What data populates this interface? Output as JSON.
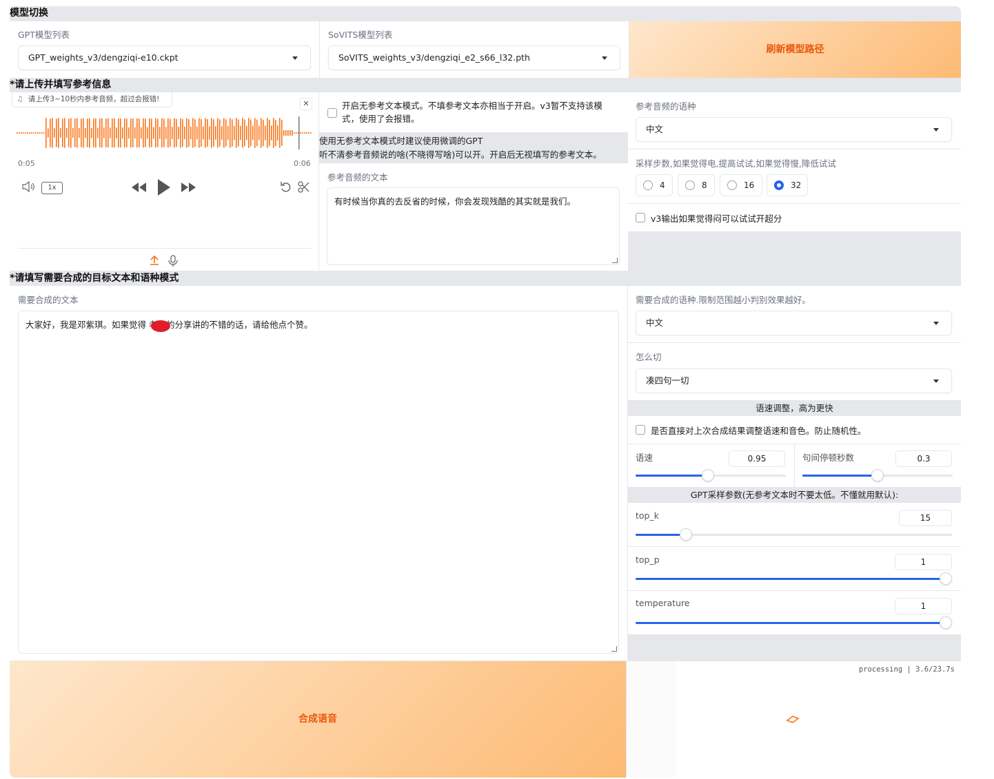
{
  "model_switch": {
    "section_title": "模型切换",
    "gpt_label": "GPT模型列表",
    "gpt_value": "GPT_weights_v3/dengziqi-e10.ckpt",
    "sovits_label": "SoVITS模型列表",
    "sovits_value": "SoVITS_weights_v3/dengziqi_e2_s66_l32.pth",
    "refresh_button": "刷新模型路径"
  },
  "reference": {
    "section_title": "*请上传并填写参考信息",
    "audio_hint": "请上传3~10秒内参考音频，超过会报错!",
    "time_current": "0:05",
    "time_total": "0:06",
    "speed": "1x",
    "no_ref_checkbox_label": "开启无参考文本模式。不填参考文本亦相当于开启。v3暂不支持该模式，使用了会报错。",
    "no_ref_note_line1": "使用无参考文本模式时建议使用微调的GPT",
    "no_ref_note_line2": "听不清参考音频说的啥(不晓得写啥)可以开。开启后无视填写的参考文本。",
    "ref_text_label": "参考音频的文本",
    "ref_text_value": "有时候当你真的去反省的时候，你会发现残酷的其实就是我们。",
    "ref_lang_label": "参考音频的语种",
    "ref_lang_value": "中文",
    "steps_label": "采样步数,如果觉得电,提高试试,如果觉得慢,降低试试",
    "steps_options": [
      "4",
      "8",
      "16",
      "32"
    ],
    "steps_selected": "32",
    "superres_label": "v3输出如果觉得闷可以试试开超分"
  },
  "synthesis": {
    "section_title": "*请填写需要合成的目标文本和语种模式",
    "target_text_label": "需要合成的文本",
    "target_text_value": "大家好，我是邓紫琪。如果觉得      老师的分享讲的不错的话，请给他点个赞。",
    "target_lang_label": "需要合成的语种.限制范围越小判别效果越好。",
    "target_lang_value": "中文",
    "cut_label": "怎么切",
    "cut_value": "凑四句一切",
    "speed_band": "语速调整，高为更快",
    "adjust_checkbox_label": "是否直接对上次合成结果调整语速和音色。防止随机性。",
    "speed_label": "语速",
    "speed_value": "0.95",
    "speed_fraction": 0.48,
    "pause_label": "句间停顿秒数",
    "pause_value": "0.3",
    "pause_fraction": 0.5,
    "gpt_band": "GPT采样参数(无参考文本时不要太低。不懂就用默认):",
    "topk_label": "top_k",
    "topk_value": "15",
    "topk_fraction": 0.16,
    "topp_label": "top_p",
    "topp_value": "1",
    "topp_fraction": 1.0,
    "temp_label": "temperature",
    "temp_value": "1",
    "temp_fraction": 1.0,
    "synth_button": "合成语音",
    "status": "processing | 3.6/23.7s"
  }
}
